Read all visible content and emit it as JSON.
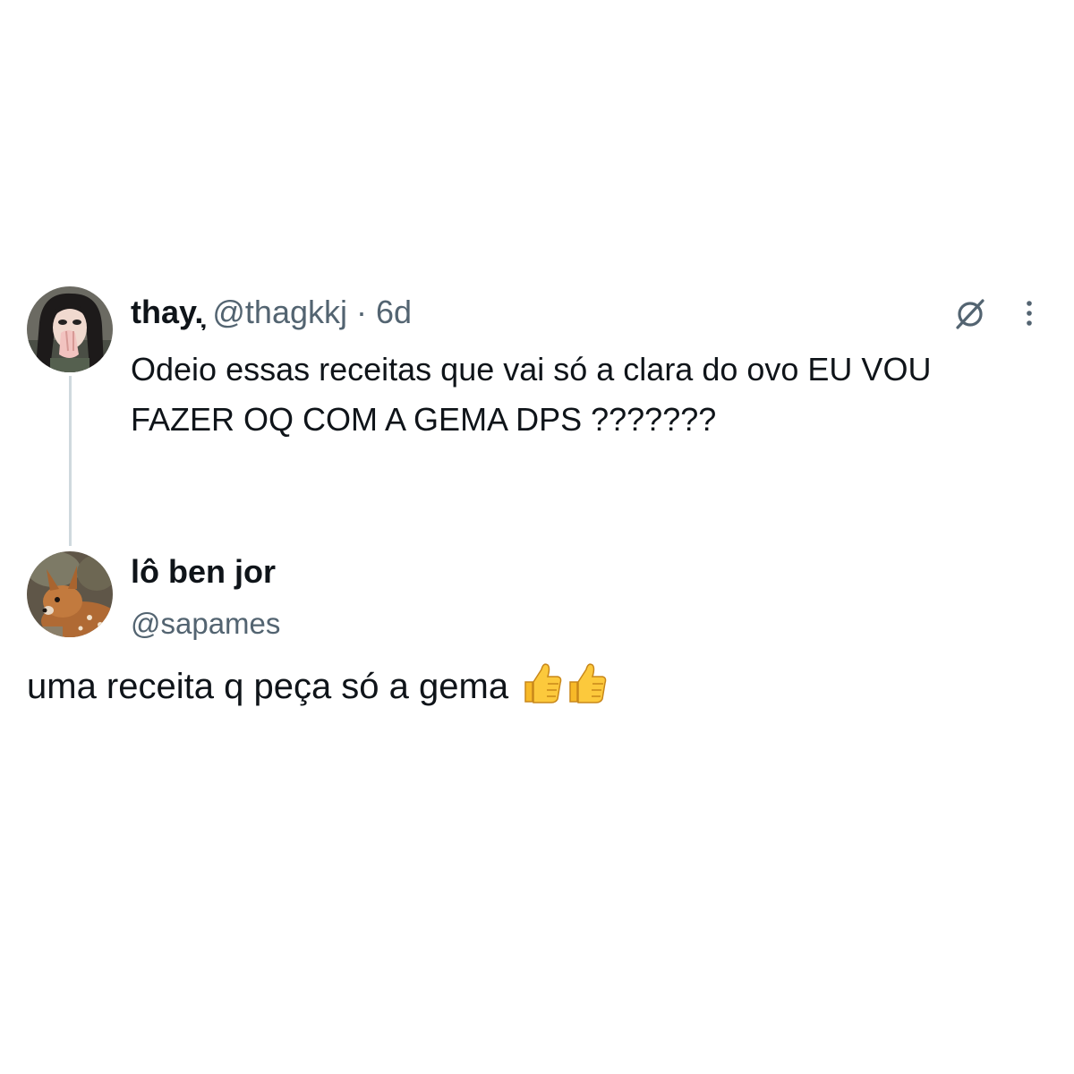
{
  "original_tweet": {
    "display_name": "thay.",
    "name_suffix": "̦",
    "handle": "@thagkkj",
    "separator": "·",
    "time": "6d",
    "text": "Odeio essas receitas que vai só a clara do ovo EU VOU FAZER OQ COM A GEMA DPS ???????",
    "avatar": "avatar-girl-covering-face",
    "icons": [
      "grok-icon",
      "more-icon"
    ]
  },
  "reply_tweet": {
    "display_name": "lô ben jor",
    "handle": "@sapames",
    "text": "uma receita q peça só a gema",
    "emojis": [
      "thumbs-up-icon",
      "thumbs-up-icon"
    ],
    "avatar": "avatar-fawn"
  },
  "colors": {
    "text_primary": "#0f1419",
    "text_secondary": "#536471",
    "thread_line": "#cfd9de",
    "emoji_yellow": "#f7c23a"
  }
}
